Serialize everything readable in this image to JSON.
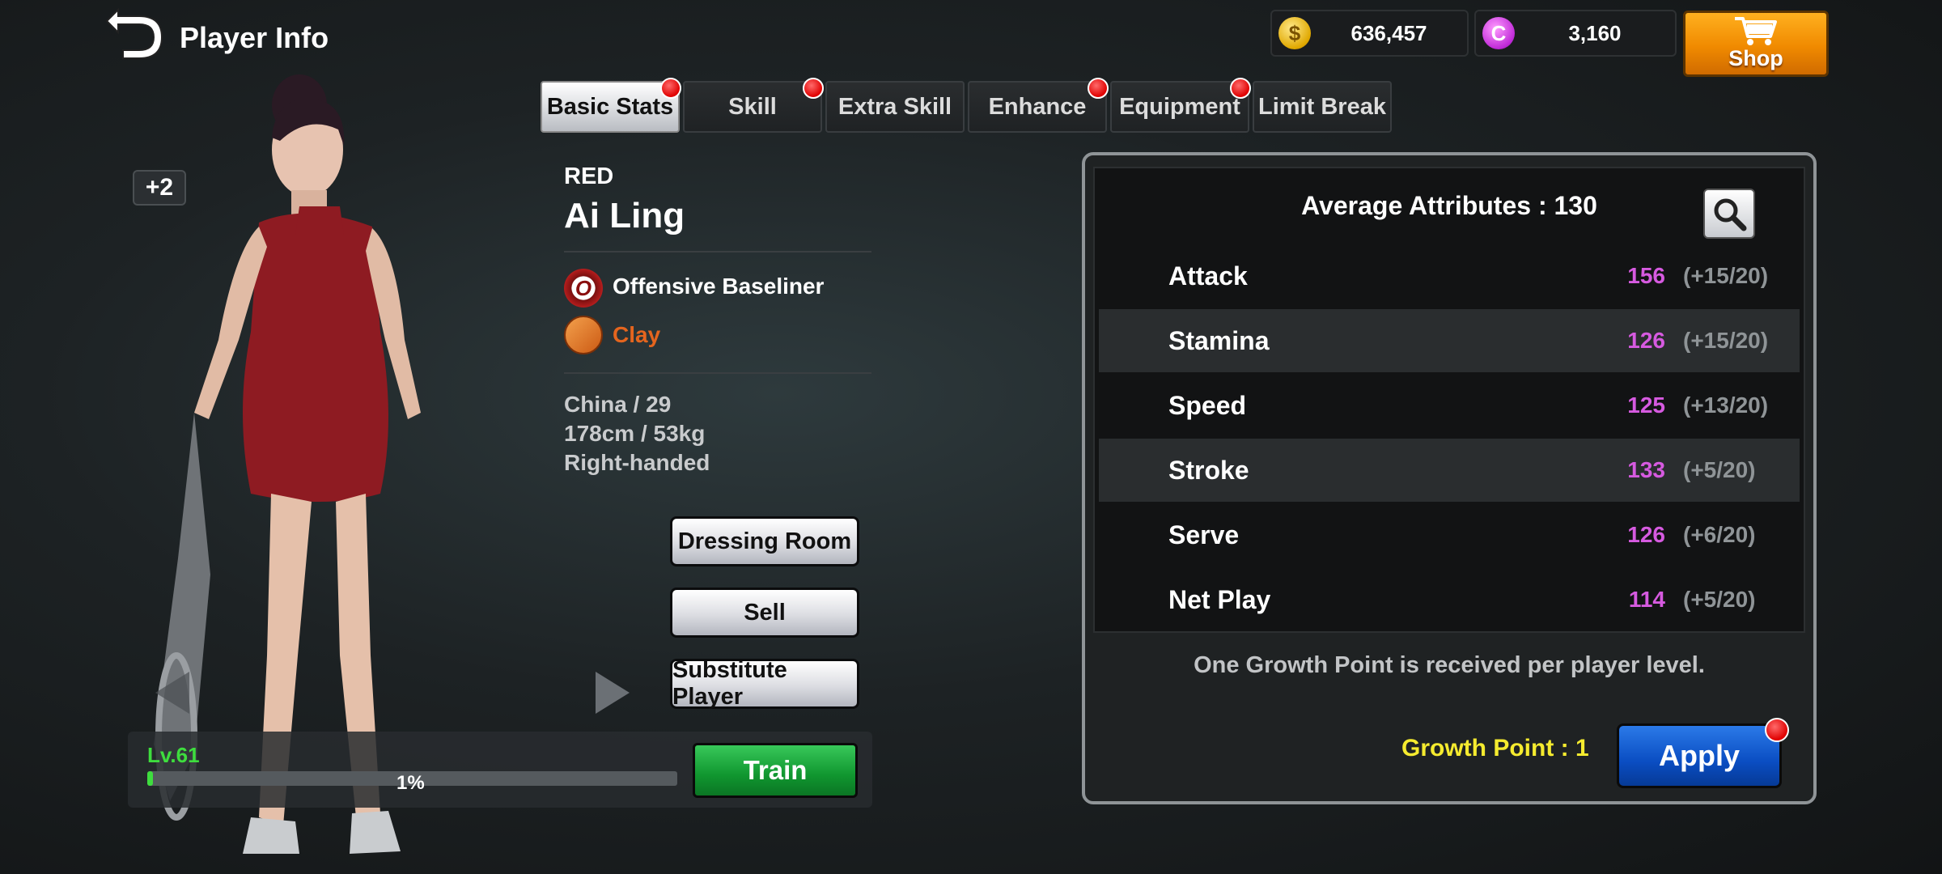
{
  "header": {
    "title": "Player Info",
    "gold": "636,457",
    "gems": "3,160",
    "gold_icon": "$",
    "gem_icon": "C",
    "shop_label": "Shop"
  },
  "tabs": [
    {
      "label": "Basic Stats",
      "active": true,
      "notify": true
    },
    {
      "label": "Skill",
      "active": false,
      "notify": true
    },
    {
      "label": "Extra Skill",
      "active": false,
      "notify": false
    },
    {
      "label": "Enhance",
      "active": false,
      "notify": true
    },
    {
      "label": "Equipment",
      "active": false,
      "notify": true
    },
    {
      "label": "Limit Break",
      "active": false,
      "notify": false
    }
  ],
  "player": {
    "plus": "+2",
    "team": "RED",
    "name": "Ai Ling",
    "style_icon": "O",
    "style": "Offensive Baseliner",
    "court": "Clay",
    "bio1": "China / 29",
    "bio2": "178cm / 53kg",
    "bio3": "Right-handed",
    "level": "Lv.61",
    "progress_text": "1%",
    "progress_value": 0.01
  },
  "actions": {
    "dressing": "Dressing Room",
    "sell": "Sell",
    "substitute": "Substitute Player",
    "train": "Train"
  },
  "stats": {
    "title": "Average Attributes : 130",
    "rows": [
      {
        "name": "Attack",
        "value": "156",
        "bonus": "(+15/20)"
      },
      {
        "name": "Stamina",
        "value": "126",
        "bonus": "(+15/20)"
      },
      {
        "name": "Speed",
        "value": "125",
        "bonus": "(+13/20)"
      },
      {
        "name": "Stroke",
        "value": "133",
        "bonus": "(+5/20)"
      },
      {
        "name": "Serve",
        "value": "126",
        "bonus": "(+6/20)"
      },
      {
        "name": "Net Play",
        "value": "114",
        "bonus": "(+5/20)"
      }
    ],
    "note": "One Growth Point is received per player level.",
    "growth": "Growth Point : 1",
    "apply": "Apply"
  },
  "colors": {
    "stat_value": "#d65ae0",
    "growth": "#f5eb2f",
    "level": "#3edd3e",
    "court": "#e5651e"
  }
}
